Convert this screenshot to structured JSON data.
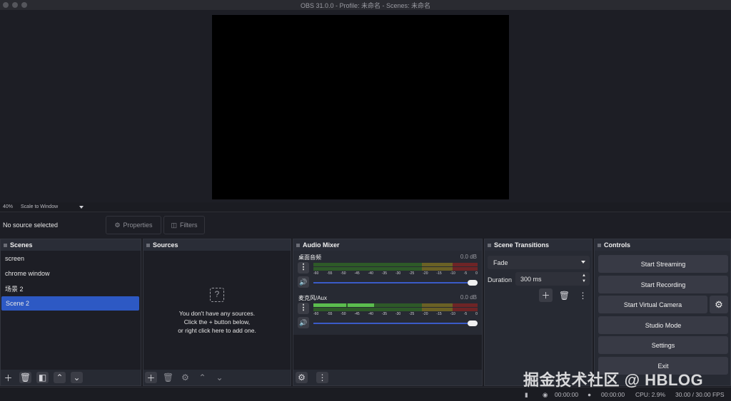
{
  "window": {
    "title": "OBS 31.0.0 - Profile: 未命名 - Scenes: 未命名"
  },
  "preview": {
    "zoom": "40%",
    "scale_mode": "Scale to Window"
  },
  "context": {
    "no_source": "No source selected",
    "properties_label": "Properties",
    "filters_label": "Filters"
  },
  "scenes": {
    "title": "Scenes",
    "items": [
      {
        "label": "screen"
      },
      {
        "label": "chrome window"
      },
      {
        "label": "场景 2"
      },
      {
        "label": "Scene 2"
      }
    ]
  },
  "sources": {
    "title": "Sources",
    "empty_line1": "You don't have any sources.",
    "empty_line2": "Click the + button below,",
    "empty_line3": "or right click here to add one."
  },
  "mixer": {
    "title": "Audio Mixer",
    "channels": [
      {
        "name": "桌面音频",
        "db": "0.0 dB",
        "volume": 1.0
      },
      {
        "name": "麦克风/Aux",
        "db": "0.0 dB",
        "volume": 1.0,
        "level_fraction": 0.43
      }
    ],
    "ticks": [
      "-60",
      "-55",
      "-50",
      "-45",
      "-40",
      "-35",
      "-30",
      "-25",
      "-20",
      "-15",
      "-10",
      "-5",
      "0"
    ]
  },
  "transitions": {
    "title": "Scene Transitions",
    "selected": "Fade",
    "duration_label": "Duration",
    "duration_value": "300 ms"
  },
  "controls": {
    "title": "Controls",
    "start_streaming": "Start Streaming",
    "start_recording": "Start Recording",
    "start_virtual_camera": "Start Virtual Camera",
    "studio_mode": "Studio Mode",
    "settings": "Settings",
    "exit": "Exit"
  },
  "status": {
    "stream_time": "00:00:00",
    "record_time": "00:00:00",
    "cpu": "CPU: 2.9%",
    "fps": "30.00 / 30.00 FPS"
  },
  "watermark": "掘金技术社区 @ HBLOG"
}
